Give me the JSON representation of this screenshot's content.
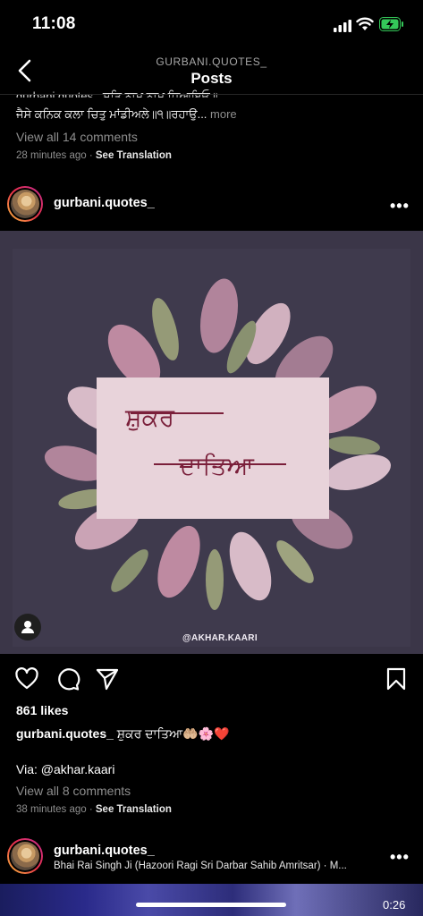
{
  "status_bar": {
    "time": "11:08"
  },
  "header": {
    "account": "GURBANI.QUOTES_",
    "title": "Posts"
  },
  "previous_post": {
    "caption_line1": "gurbani.quotes_ ਸਤਿ ਨਾਮੁ ਨਾਮੁ ਧਿਆਇਓ॥",
    "caption_line2": "ਜੈਸੇ ਕਨਿਕ ਕਲਾ ਚਿਤੁ ਮਾਂਡੀਅਲੇ॥੧॥ਰਹਾਉ...",
    "more": " more",
    "comments_link": "View all 14 comments",
    "time": "28 minutes ago",
    "see_translation": "See Translation"
  },
  "post": {
    "username": "gurbani.quotes_",
    "image_text_line1": "ਸ਼ੁਕਰ",
    "image_text_line2": "ਦਾਤਿਆ",
    "image_credit": "@AKHAR.KAARI",
    "likes": "861 likes",
    "caption_user": "gurbani.quotes_",
    "caption_text": " ਸ਼ੁਕਰ ਦਾਤਿਆ🤲🏼🌸❤️",
    "via": "Via: @akhar.kaari",
    "comments_link": "View all 8 comments",
    "time": "38 minutes ago",
    "see_translation": "See Translation"
  },
  "next_post": {
    "username": "gurbani.quotes_",
    "audio": "Bhai Rai Singh Ji (Hazoori Ragi Sri Darbar Sahib Amritsar) · M...",
    "duration": "0:26"
  },
  "colors": {
    "accent_battery": "#34c759",
    "muted": "#8e8e8e",
    "image_bg": "#3b3648"
  }
}
